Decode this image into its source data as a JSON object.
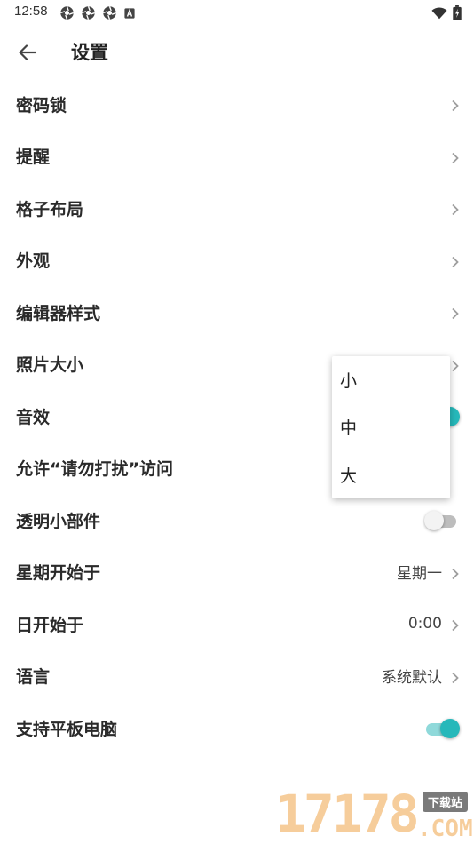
{
  "status_bar": {
    "time": "12:58",
    "notification_icons": [
      "aperture-icon",
      "aperture-icon",
      "aperture-icon",
      "a-badge-icon"
    ],
    "right_icons": [
      "wifi-icon",
      "battery-charging-icon"
    ]
  },
  "app_bar": {
    "title": "设置",
    "back_icon": "arrow-left-icon"
  },
  "settings": [
    {
      "label": "密码锁",
      "control": "chevron"
    },
    {
      "label": "提醒",
      "control": "chevron"
    },
    {
      "label": "格子布局",
      "control": "chevron"
    },
    {
      "label": "外观",
      "control": "chevron"
    },
    {
      "label": "编辑器样式",
      "control": "chevron"
    },
    {
      "label": "照片大小",
      "control": "chevron"
    },
    {
      "label": "音效",
      "control": "switch",
      "on": true
    },
    {
      "label": "允许“请勿打扰”访问",
      "control": "none"
    },
    {
      "label": "透明小部件",
      "control": "switch",
      "on": false
    },
    {
      "label": "星期开始于",
      "control": "value",
      "value": "星期一"
    },
    {
      "label": "日开始于",
      "control": "value",
      "value": "0:00"
    },
    {
      "label": "语言",
      "control": "value",
      "value": "系统默认"
    },
    {
      "label": "支持平板电脑",
      "control": "switch",
      "on": true
    }
  ],
  "photo_size_menu": {
    "options": [
      "小",
      "中",
      "大"
    ]
  },
  "watermark": {
    "number": "17178",
    "badge": "下载站",
    "domain": ".COM"
  },
  "colors": {
    "accent": "#26b8ba",
    "accent_track": "#8fd9da",
    "text": "#2a2a2a",
    "chevron": "#9e9e9e"
  }
}
